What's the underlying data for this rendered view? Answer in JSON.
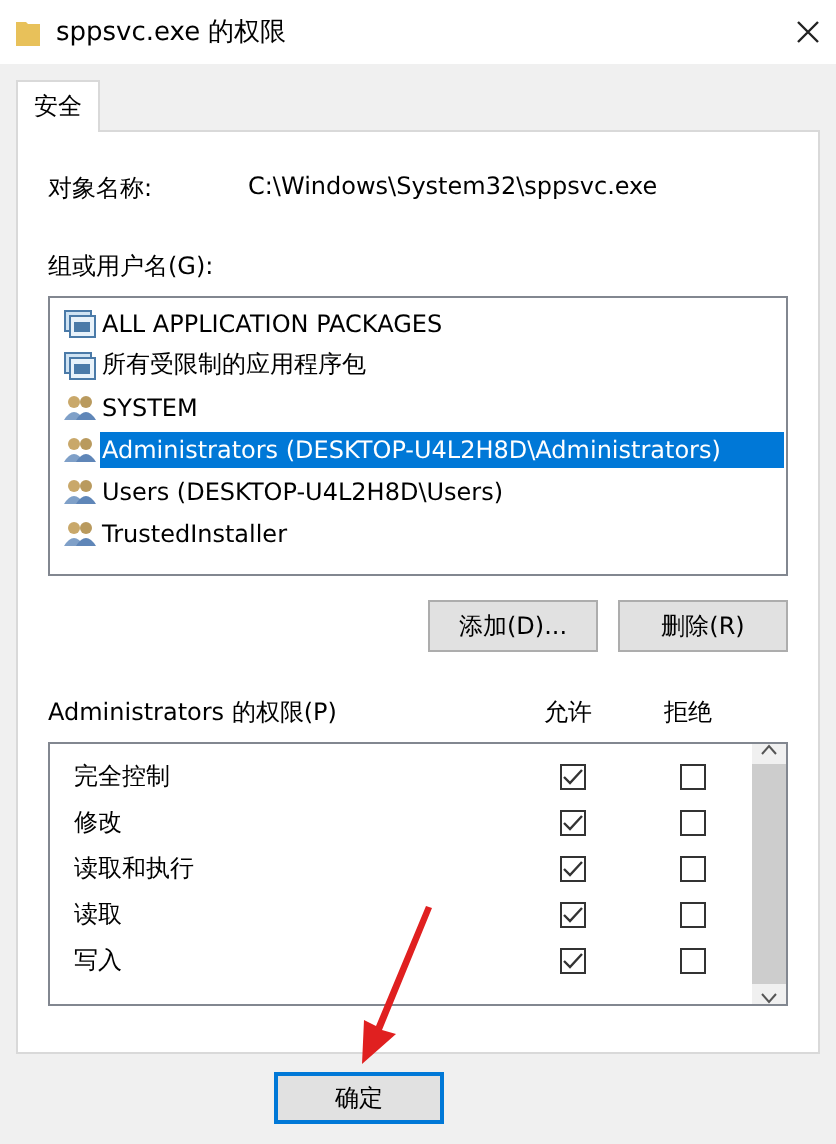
{
  "window": {
    "title": "sppsvc.exe 的权限"
  },
  "tabs": [
    {
      "label": "安全",
      "selected": true
    }
  ],
  "object_name": {
    "label": "对象名称:",
    "value": "C:\\Windows\\System32\\sppsvc.exe"
  },
  "groups": {
    "label": "组或用户名(G):",
    "items": [
      {
        "name": "ALL APPLICATION PACKAGES",
        "kind": "package",
        "selected": false
      },
      {
        "name": "所有受限制的应用程序包",
        "kind": "package",
        "selected": false
      },
      {
        "name": "SYSTEM",
        "kind": "users",
        "selected": false
      },
      {
        "name": "Administrators (DESKTOP-U4L2H8D\\Administrators)",
        "kind": "users",
        "selected": true
      },
      {
        "name": "Users (DESKTOP-U4L2H8D\\Users)",
        "kind": "users",
        "selected": false
      },
      {
        "name": "TrustedInstaller",
        "kind": "users",
        "selected": false
      }
    ],
    "buttons": [
      "添加(D)...",
      "删除(R)"
    ]
  },
  "permissions": {
    "label": "Administrators 的权限(P)",
    "allow_header": "允许",
    "deny_header": "拒绝",
    "rows": [
      {
        "name": "完全控制",
        "allow": true,
        "deny": false
      },
      {
        "name": "修改",
        "allow": true,
        "deny": false
      },
      {
        "name": "读取和执行",
        "allow": true,
        "deny": false
      },
      {
        "name": "读取",
        "allow": true,
        "deny": false
      },
      {
        "name": "写入",
        "allow": true,
        "deny": false
      }
    ]
  },
  "footer_buttons": [
    "确定"
  ]
}
